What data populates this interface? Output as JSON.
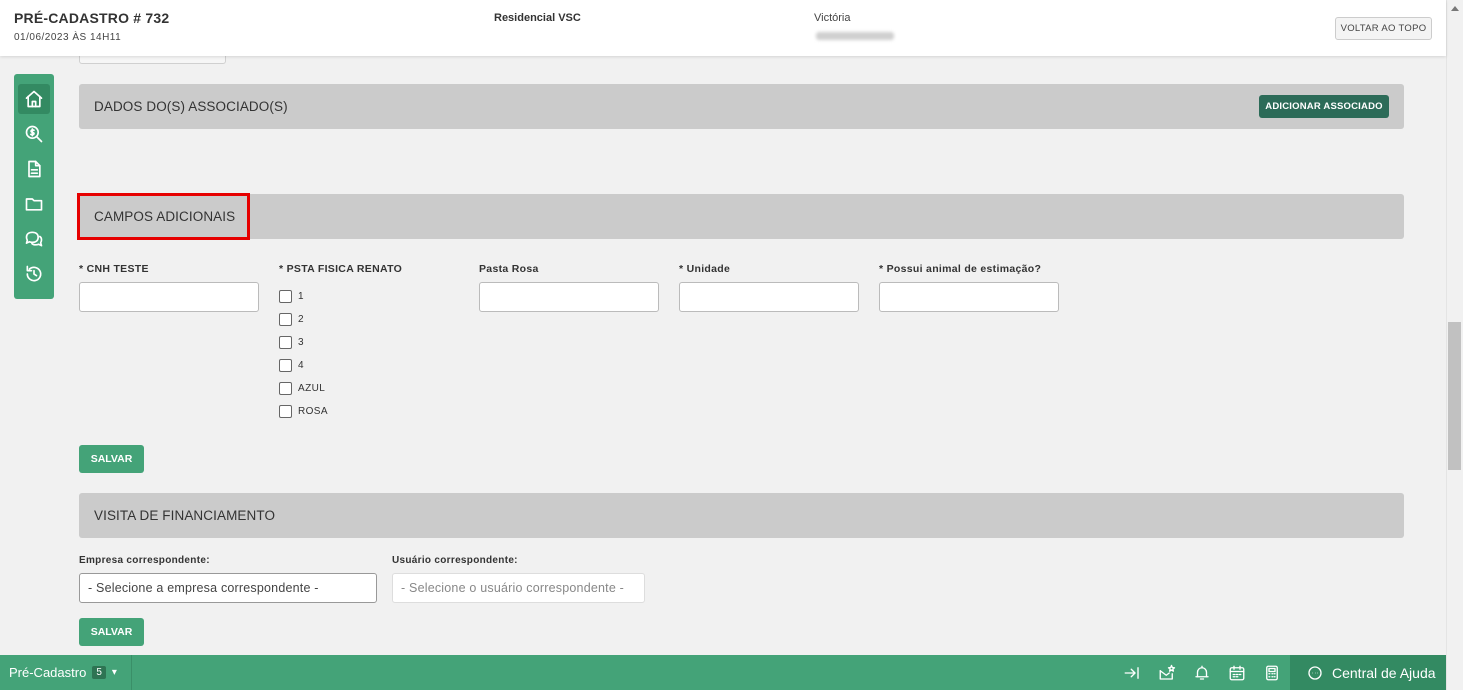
{
  "header": {
    "title": "PRÉ-CADASTRO # 732",
    "date": "01/06/2023 ÀS 14H11",
    "empreendimento": "Residencial VSC",
    "user_name": "Victória",
    "back_to_top_label": "VOLTAR AO TOPO"
  },
  "sidenav": {
    "items": [
      {
        "icon": "home-icon",
        "active": true
      },
      {
        "icon": "search-dollar-icon"
      },
      {
        "icon": "document-icon"
      },
      {
        "icon": "folder-icon"
      },
      {
        "icon": "chat-icon"
      },
      {
        "icon": "history-icon"
      }
    ]
  },
  "sections": {
    "associados": {
      "title": "DADOS DO(S) ASSOCIADO(S)",
      "add_button": "ADICIONAR ASSOCIADO"
    },
    "campos_adicionais": {
      "title": "CAMPOS ADICIONAIS",
      "fields": {
        "cnh": {
          "label": "* CNH TESTE",
          "value": ""
        },
        "psta": {
          "label": "* PSTA FISICA RENATO"
        },
        "pasta_rosa": {
          "label": "Pasta Rosa",
          "value": ""
        },
        "unidade": {
          "label": "* Unidade",
          "value": ""
        },
        "animal": {
          "label": "* Possui animal de estimação?",
          "value": ""
        }
      },
      "checkboxes": [
        "1",
        "2",
        "3",
        "4",
        "AZUL",
        "ROSA"
      ],
      "save_label": "SALVAR"
    },
    "visita": {
      "title": "VISITA DE FINANCIAMENTO",
      "empresa_label": "Empresa correspondente:",
      "empresa_value": "- Selecione a empresa correspondente -",
      "usuario_label": "Usuário correspondente:",
      "usuario_value": "- Selecione o usuário correspondente -",
      "save_label": "SALVAR"
    }
  },
  "footer": {
    "tab_label": "Pré-Cadastro",
    "tab_count": "5",
    "help_label": "Central de Ajuda",
    "icons": [
      "collapse-right-icon",
      "mail-star-icon",
      "bell-icon",
      "calendar-icon",
      "calculator-icon"
    ]
  },
  "colors": {
    "accent": "#44a378",
    "accent_dark": "#2c6b58",
    "section_bg": "#cbcbcb",
    "highlight": "#e60000"
  }
}
